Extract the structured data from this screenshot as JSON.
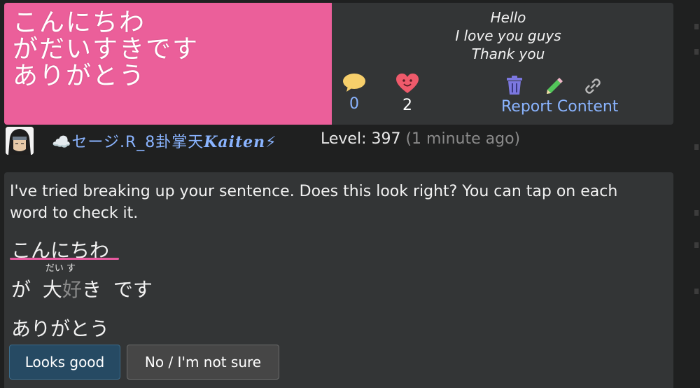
{
  "post": {
    "image_lines": [
      "こんにちわ",
      "がだいすきです",
      "ありがとう"
    ],
    "translation_lines": [
      "Hello",
      "I love you guys",
      "Thank you"
    ],
    "comment_count": "0",
    "like_count": "2",
    "report_label": "Report Content",
    "colors": {
      "image_bg": "#eb5f9a",
      "link": "#8ab4ff"
    }
  },
  "user": {
    "name_prefix": "☁️セージ.",
    "name_mid": "R_8",
    "name_kanji": "卦掌天",
    "name_bold": "Kaiten",
    "name_suffix": "⚡",
    "level_label": "Level: 397",
    "time_ago": "(1 minute ago)"
  },
  "reply": {
    "message": "I've tried breaking up your sentence. Does this look right? You can tap on each word to check it.",
    "line1": "こんにちわ",
    "line2": {
      "w1": "が",
      "w2_base1": "大",
      "w2_base2": "好",
      "w2_base3": "き",
      "w2_ruby": "だい す",
      "w3": "です"
    },
    "line3": "ありがとう",
    "good_button": "Looks good",
    "notsure_button": "No / I'm not sure"
  }
}
